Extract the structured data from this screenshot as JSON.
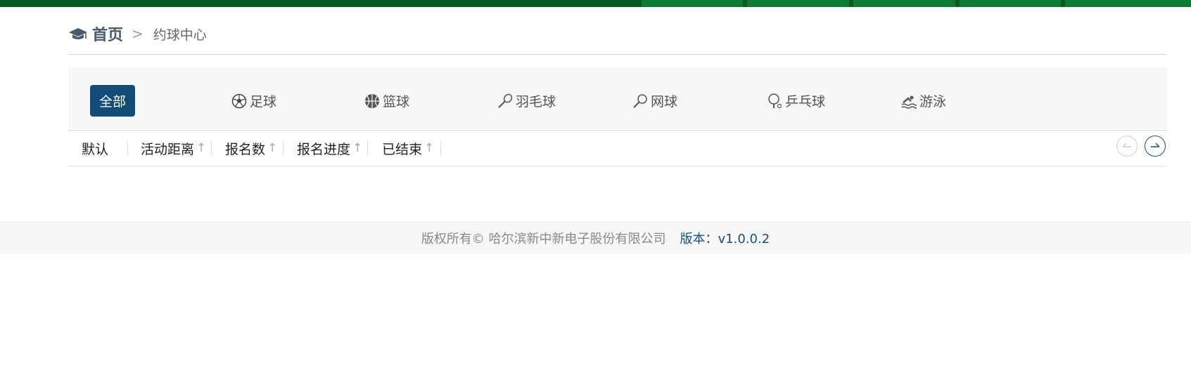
{
  "breadcrumb": {
    "home": "首页",
    "current": "约球中心"
  },
  "tabs": [
    {
      "label": "全部",
      "icon": "all"
    },
    {
      "label": "足球",
      "icon": "soccer-ball-icon"
    },
    {
      "label": "篮球",
      "icon": "basketball-icon"
    },
    {
      "label": "羽毛球",
      "icon": "badminton-racket-icon"
    },
    {
      "label": "网球",
      "icon": "tennis-racket-icon"
    },
    {
      "label": "乒乓球",
      "icon": "ping-pong-icon"
    },
    {
      "label": "游泳",
      "icon": "swimming-icon"
    }
  ],
  "sort": {
    "default": "默认",
    "distance": "活动距离",
    "signups": "报名数",
    "progress": "报名进度",
    "ended": "已结束",
    "arrow": "↑"
  },
  "footer": {
    "copyright": "版权所有© 哈尔滨新中新电子股份有限公司",
    "version": "版本：v1.0.0.2"
  },
  "colors": {
    "accent": "#114d78",
    "topbar": "#0b5a25"
  }
}
